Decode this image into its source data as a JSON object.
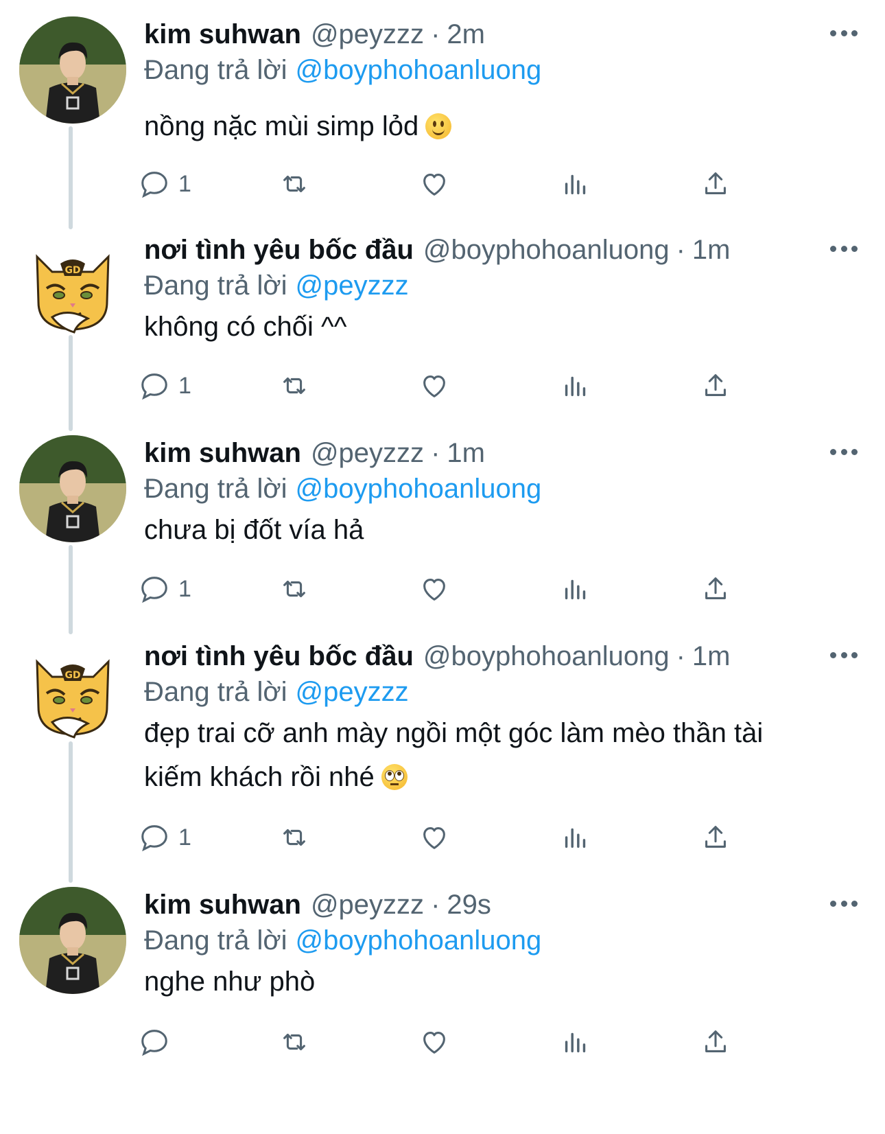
{
  "tweets": [
    {
      "author": {
        "name": "kim suhwan",
        "handle": "@peyzzz",
        "avatar": "photo-avatar"
      },
      "time": "2m",
      "reply_prefix": "Đang trả lời",
      "reply_to": "@boyphohoanluong",
      "text": "nồng nặc mùi simp lỏd",
      "emoji": "slightly-smiling-face",
      "reply_count": "1"
    },
    {
      "author": {
        "name": "nơi tình yêu bốc đầu",
        "handle": "@boyphohoanluong",
        "avatar": "cat-avatar"
      },
      "time": "1m",
      "reply_prefix": "Đang trả lời",
      "reply_to": "@peyzzz",
      "text": "không có chối ^^",
      "reply_count": "1"
    },
    {
      "author": {
        "name": "kim suhwan",
        "handle": "@peyzzz",
        "avatar": "photo-avatar"
      },
      "time": "1m",
      "reply_prefix": "Đang trả lời",
      "reply_to": "@boyphohoanluong",
      "text": "chưa bị đốt vía hả",
      "reply_count": "1"
    },
    {
      "author": {
        "name": "nơi tình yêu bốc đầu",
        "handle": "@boyphohoanluong",
        "avatar": "cat-avatar"
      },
      "time": "1m",
      "reply_prefix": "Đang trả lời",
      "reply_to": "@peyzzz",
      "text_line1": "đẹp trai cỡ anh mày ngồi một góc làm mèo thần tài",
      "text_line2": "kiếm khách rồi nhé",
      "emoji": "face-with-rolling-eyes",
      "reply_count": "1"
    },
    {
      "author": {
        "name": "kim suhwan",
        "handle": "@peyzzz",
        "avatar": "photo-avatar"
      },
      "time": "29s",
      "reply_prefix": "Đang trả lời",
      "reply_to": "@boyphohoanluong",
      "text": "nghe như phò",
      "reply_count": ""
    }
  ],
  "separator": "·",
  "colors": {
    "text": "#0f1419",
    "muted": "#536471",
    "link": "#1d9bf0",
    "thread_line": "#cfd9de"
  },
  "action_icons": [
    "reply-icon",
    "retweet-icon",
    "like-icon",
    "views-icon",
    "share-icon"
  ]
}
